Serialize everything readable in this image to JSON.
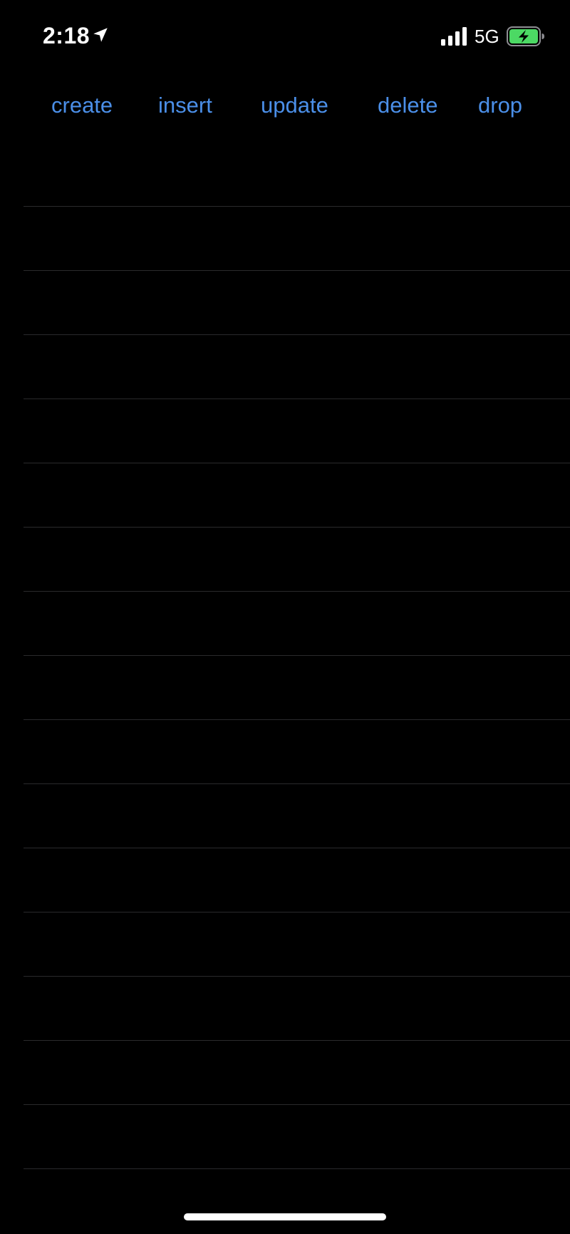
{
  "status_bar": {
    "time": "2:18",
    "network": "5G",
    "icons": {
      "location": "location-arrow-icon",
      "signal": "cellular-signal-icon",
      "battery": "battery-charging-icon"
    },
    "battery_color": "#4cd964"
  },
  "toolbar": {
    "accent_color": "#4b8fe8",
    "buttons": [
      {
        "label": "create"
      },
      {
        "label": "insert"
      },
      {
        "label": "update"
      },
      {
        "label": "delete"
      },
      {
        "label": "drop"
      }
    ]
  },
  "list": {
    "rows": [
      {
        "text": ""
      },
      {
        "text": ""
      },
      {
        "text": ""
      },
      {
        "text": ""
      },
      {
        "text": ""
      },
      {
        "text": ""
      },
      {
        "text": ""
      },
      {
        "text": ""
      },
      {
        "text": ""
      },
      {
        "text": ""
      },
      {
        "text": ""
      },
      {
        "text": ""
      },
      {
        "text": ""
      },
      {
        "text": ""
      },
      {
        "text": ""
      },
      {
        "text": ""
      }
    ]
  }
}
